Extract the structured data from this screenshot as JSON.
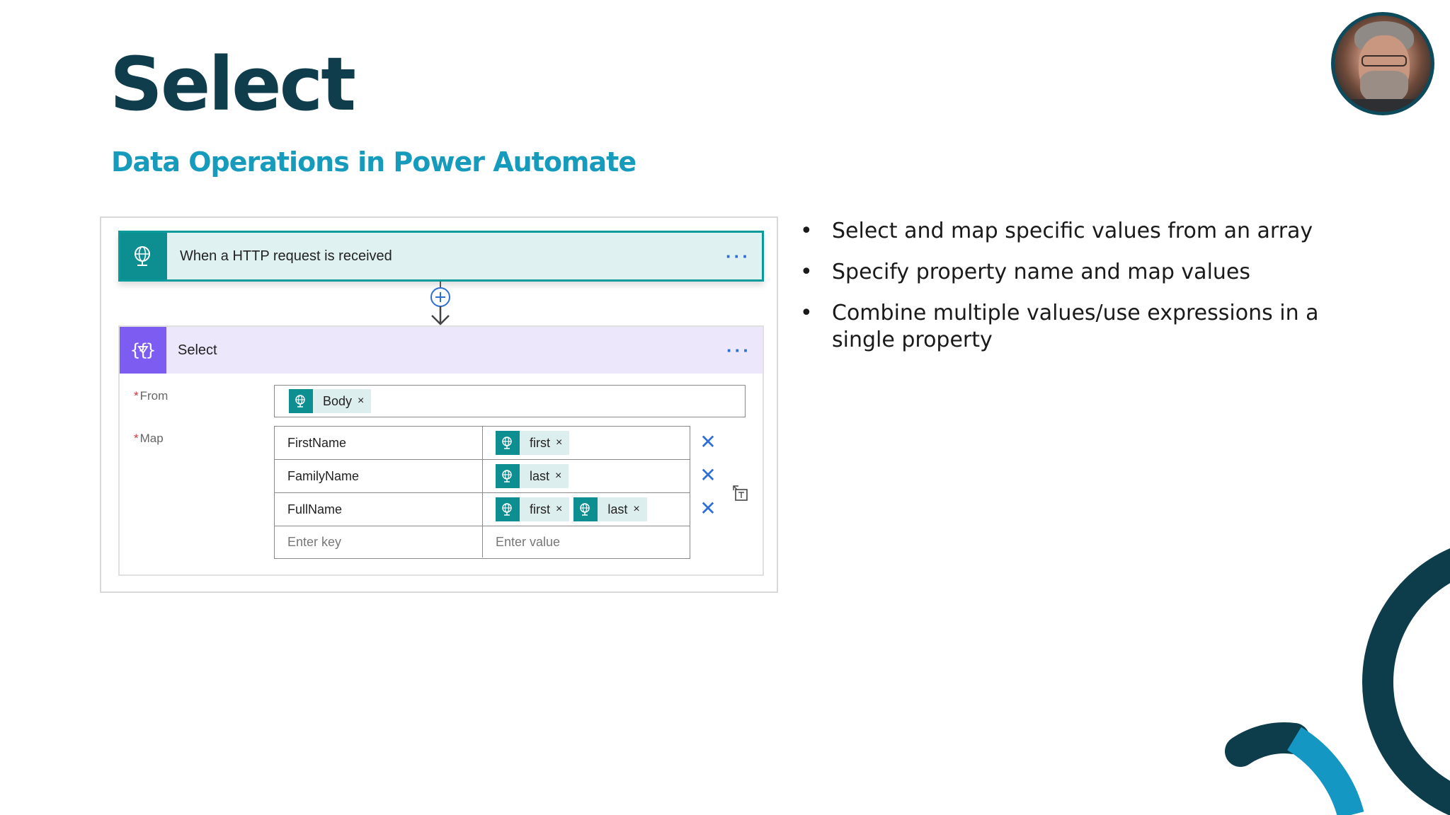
{
  "slide": {
    "title": "Select",
    "subtitle": "Data Operations in Power Automate"
  },
  "flow": {
    "trigger": {
      "title": "When a HTTP request is received",
      "icon": "globe-request-icon",
      "more": "···",
      "accent": "#0d8f91"
    },
    "connector": {
      "icon": "add-step-icon"
    },
    "action": {
      "title": "Select",
      "icon": "data-operation-icon",
      "more": "···",
      "accent": "#7c5cf1",
      "from": {
        "required_mark": "*",
        "label": "From",
        "token": {
          "label": "Body",
          "remove": "×"
        }
      },
      "map": {
        "required_mark": "*",
        "label": "Map",
        "rows": [
          {
            "key": "FirstName",
            "tokens": [
              {
                "label": "first",
                "remove": "×"
              }
            ],
            "delete": "✕"
          },
          {
            "key": "FamilyName",
            "tokens": [
              {
                "label": "last",
                "remove": "×"
              }
            ],
            "delete": "✕"
          },
          {
            "key": "FullName",
            "tokens": [
              {
                "label": "first",
                "remove": "×"
              },
              {
                "label": "last",
                "remove": "×"
              }
            ],
            "delete": "✕"
          }
        ],
        "new_row": {
          "key_placeholder": "Enter key",
          "value_placeholder": "Enter value"
        },
        "switch_mode_icon": "switch-to-text-mode-icon"
      }
    }
  },
  "bullets": {
    "marker": "•",
    "items": [
      "Select and map specific values from an array",
      "Specify property name and map values",
      "Combine multiple values/use expressions in a single property"
    ]
  },
  "colors": {
    "title": "#0f3d4c",
    "subtitle": "#179bbd",
    "deco_dark": "#0d3c4b",
    "deco_light": "#1597c4"
  }
}
